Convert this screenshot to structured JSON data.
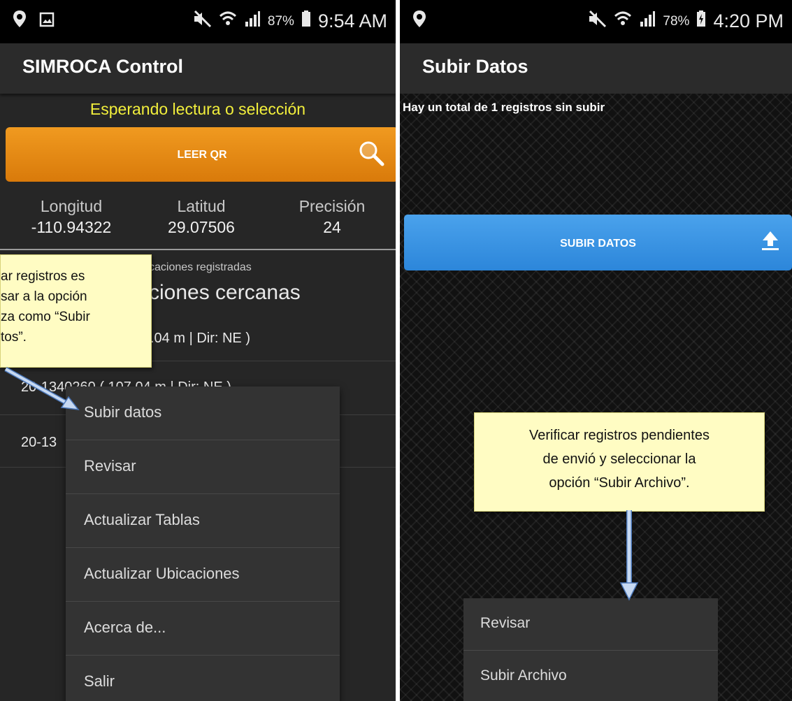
{
  "left": {
    "statusbar": {
      "battery": "87%",
      "time": "9:54 AM"
    },
    "title": "SIMROCA Control",
    "status_message": "Esperando lectura o selección",
    "qr_button": "LEER QR",
    "coords": [
      {
        "label": "Longitud",
        "value": "-110.94322"
      },
      {
        "label": "Latitud",
        "value": "29.07506"
      },
      {
        "label": "Precisión",
        "value": "24"
      }
    ],
    "nearby_subtitle": "caciones registradas",
    "nearby_title": "ciones cercanas",
    "rows": [
      ".04 m | Dir: NE )",
      "20-1340260 ( 107.04 m | Dir: NE )",
      "20-13"
    ],
    "menu": [
      "Subir datos",
      "Revisar",
      "Actualizar Tablas",
      "Actualizar Ubicaciones",
      "Acerca de...",
      "Salir"
    ],
    "callout": "ar registros es\nsar a la opción\nza como “Subir\ntos”."
  },
  "right": {
    "statusbar": {
      "battery": "78%",
      "time": "4:20 PM"
    },
    "title": "Subir Datos",
    "total_message": "Hay un total de 1 registros sin subir",
    "upload_button": "SUBIR DATOS",
    "callout": "Verificar registros pendientes\nde envió y seleccionar la\nopción “Subir Archivo”.",
    "menu": [
      "Revisar",
      "Subir Archivo"
    ]
  },
  "colors": {
    "status_yellow": "#f2ef3c",
    "orange_button": "#e88a14",
    "blue_button": "#3a94e4",
    "callout_bg": "#fffcc3",
    "arrow": "#c7d9f2"
  },
  "icons": [
    "location-pin-icon",
    "image-icon",
    "mute-icon",
    "wifi-icon",
    "signal-icon",
    "battery-icon",
    "search-icon",
    "upload-icon"
  ]
}
